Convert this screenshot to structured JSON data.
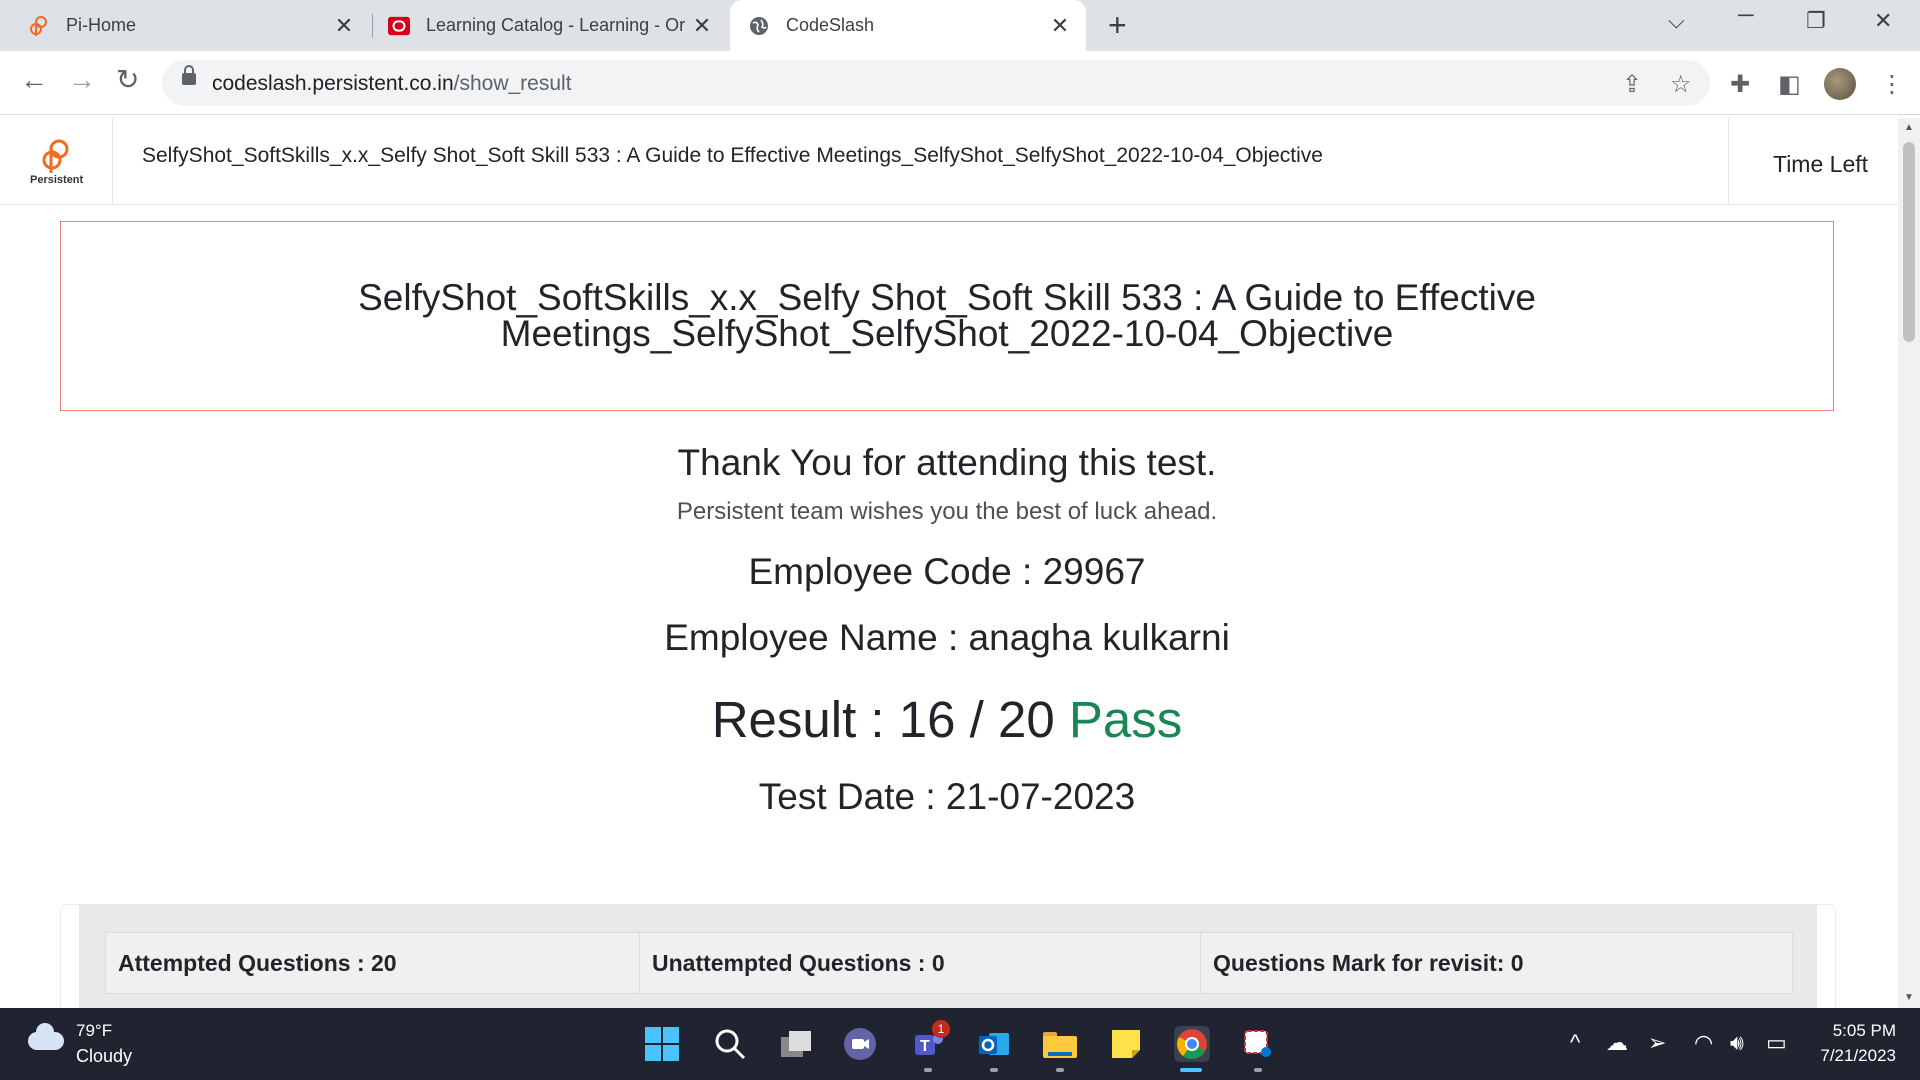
{
  "browser": {
    "tabs": [
      {
        "title": "Pi-Home",
        "icon": "persistent-logo-icon"
      },
      {
        "title": "Learning Catalog - Learning - Or",
        "icon": "oracle-icon"
      },
      {
        "title": "CodeSlash",
        "icon": "globe-icon",
        "active": true
      }
    ],
    "url_domain": "codeslash.persistent.co.in",
    "url_path": "/show_result"
  },
  "header": {
    "logo_text": "Persistent",
    "title": "SelfyShot_SoftSkills_x.x_Selfy Shot_Soft Skill 533 : A Guide to Effective Meetings_SelfyShot_SelfyShot_2022-10-04_Objective",
    "time_left_label": "Time Left"
  },
  "result_page": {
    "test_title": "SelfyShot_SoftSkills_x.x_Selfy Shot_Soft Skill 533 : A Guide to Effective Meetings_SelfyShot_SelfyShot_2022-10-04_Objective",
    "thank_you": "Thank You for attending this test.",
    "wishes": "Persistent team wishes you the best of luck ahead.",
    "employee_code": "Employee Code : 29967",
    "employee_name": "Employee Name : anagha kulkarni",
    "result_label": "Result : 16 / 20",
    "result_status": "Pass",
    "test_date": "Test Date : 21-07-2023",
    "stats": {
      "attempted": "Attempted Questions : 20",
      "unattempted": "Unattempted Questions : 0",
      "revisit": "Questions Mark for revisit: 0"
    }
  },
  "taskbar": {
    "temperature": "79°F",
    "condition": "Cloudy",
    "teams_badge": "1",
    "time": "5:05 PM",
    "date": "7/21/2023"
  },
  "colors": {
    "pass": "#198754",
    "title_border": "#f08080",
    "brand_orange": "#f26b21"
  }
}
